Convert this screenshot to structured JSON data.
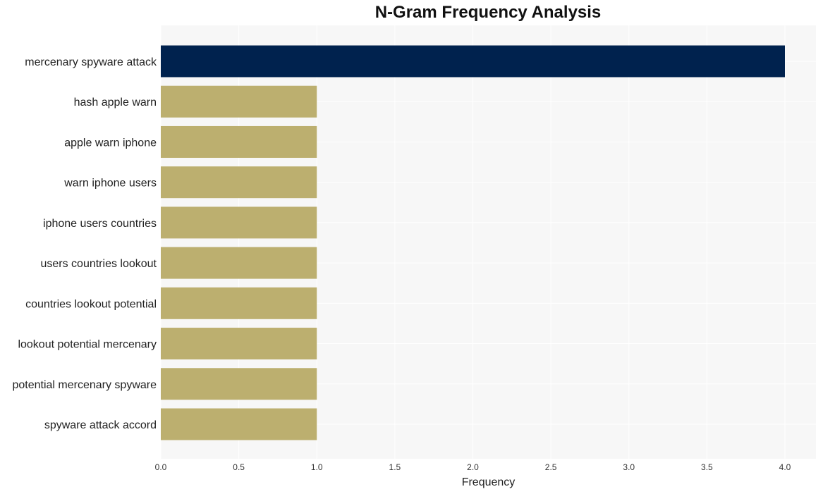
{
  "chart_data": {
    "type": "bar",
    "orientation": "horizontal",
    "title": "N-Gram Frequency Analysis",
    "xlabel": "Frequency",
    "ylabel": "",
    "xlim": [
      0,
      4.2
    ],
    "xticks": [
      "0.0",
      "0.5",
      "1.0",
      "1.5",
      "2.0",
      "2.5",
      "3.0",
      "3.5",
      "4.0"
    ],
    "xtick_values": [
      0,
      0.5,
      1.0,
      1.5,
      2.0,
      2.5,
      3.0,
      3.5,
      4.0
    ],
    "grid": true,
    "categories": [
      "mercenary spyware attack",
      "hash apple warn",
      "apple warn iphone",
      "warn iphone users",
      "iphone users countries",
      "users countries lookout",
      "countries lookout potential",
      "lookout potential mercenary",
      "potential mercenary spyware",
      "spyware attack accord"
    ],
    "values": [
      4,
      1,
      1,
      1,
      1,
      1,
      1,
      1,
      1,
      1
    ],
    "colors": {
      "highlight": "#00224e",
      "default": "#bcaf6f",
      "plot_background": "#f7f7f7",
      "gridline": "#ffffff"
    }
  }
}
